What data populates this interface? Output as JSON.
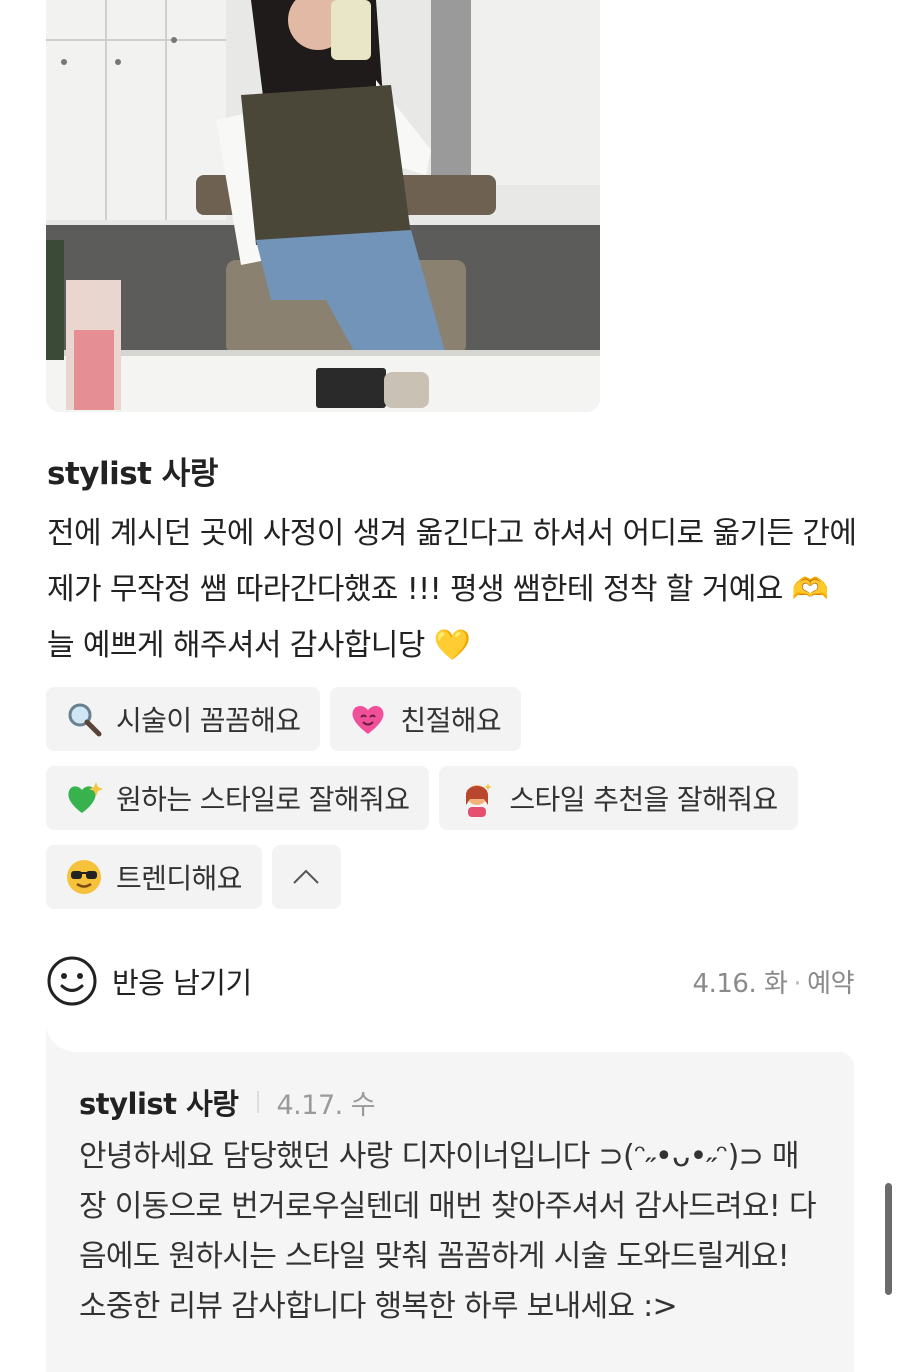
{
  "review": {
    "author": "stylist 사랑",
    "text": "전에 계시던 곳에 사정이 생겨 옮긴다고 하셔서 어디로 옮기든 간에 제가 무작정 쌤 따라간다했죠 !!! 평생 쌤한테 정착 할 거예요 🫶 늘 예쁘게 해주셔서 감사합니당 💛"
  },
  "tags": [
    {
      "icon": "magnifier-icon",
      "label": "시술이 꼼꼼해요"
    },
    {
      "icon": "heart-icon",
      "label": "친절해요"
    },
    {
      "icon": "sparkle-heart-icon",
      "label": "원하는 스타일로 잘해줘요"
    },
    {
      "icon": "hairdresser-icon",
      "label": "스타일 추천을 잘해줘요"
    },
    {
      "icon": "sunglasses-face-icon",
      "label": "트렌디해요"
    }
  ],
  "reaction": {
    "label": "반응 남기기",
    "date": "4.16. 화",
    "type": "예약"
  },
  "reply": {
    "author": "stylist 사랑",
    "date": "4.17. 수",
    "text": "안녕하세요 담당했던 사랑 디자이너입니다 ⊃(ᵔ˶•ᴗ•˶ᵔ)⊃ 매장 이동으로 번거로우실텐데 매번 찾아주셔서 감사드려요! 다음에도 원하시는 스타일 맞춰 꼼꼼하게 시술 도와드릴게요! 소중한 리뷰 감사합니다 행복한 하루 보내세요 :>"
  },
  "colors": {
    "tag_bg": "#f3f3f4",
    "reply_bg": "#f5f5f6",
    "meta_text": "#8a8a8a"
  }
}
